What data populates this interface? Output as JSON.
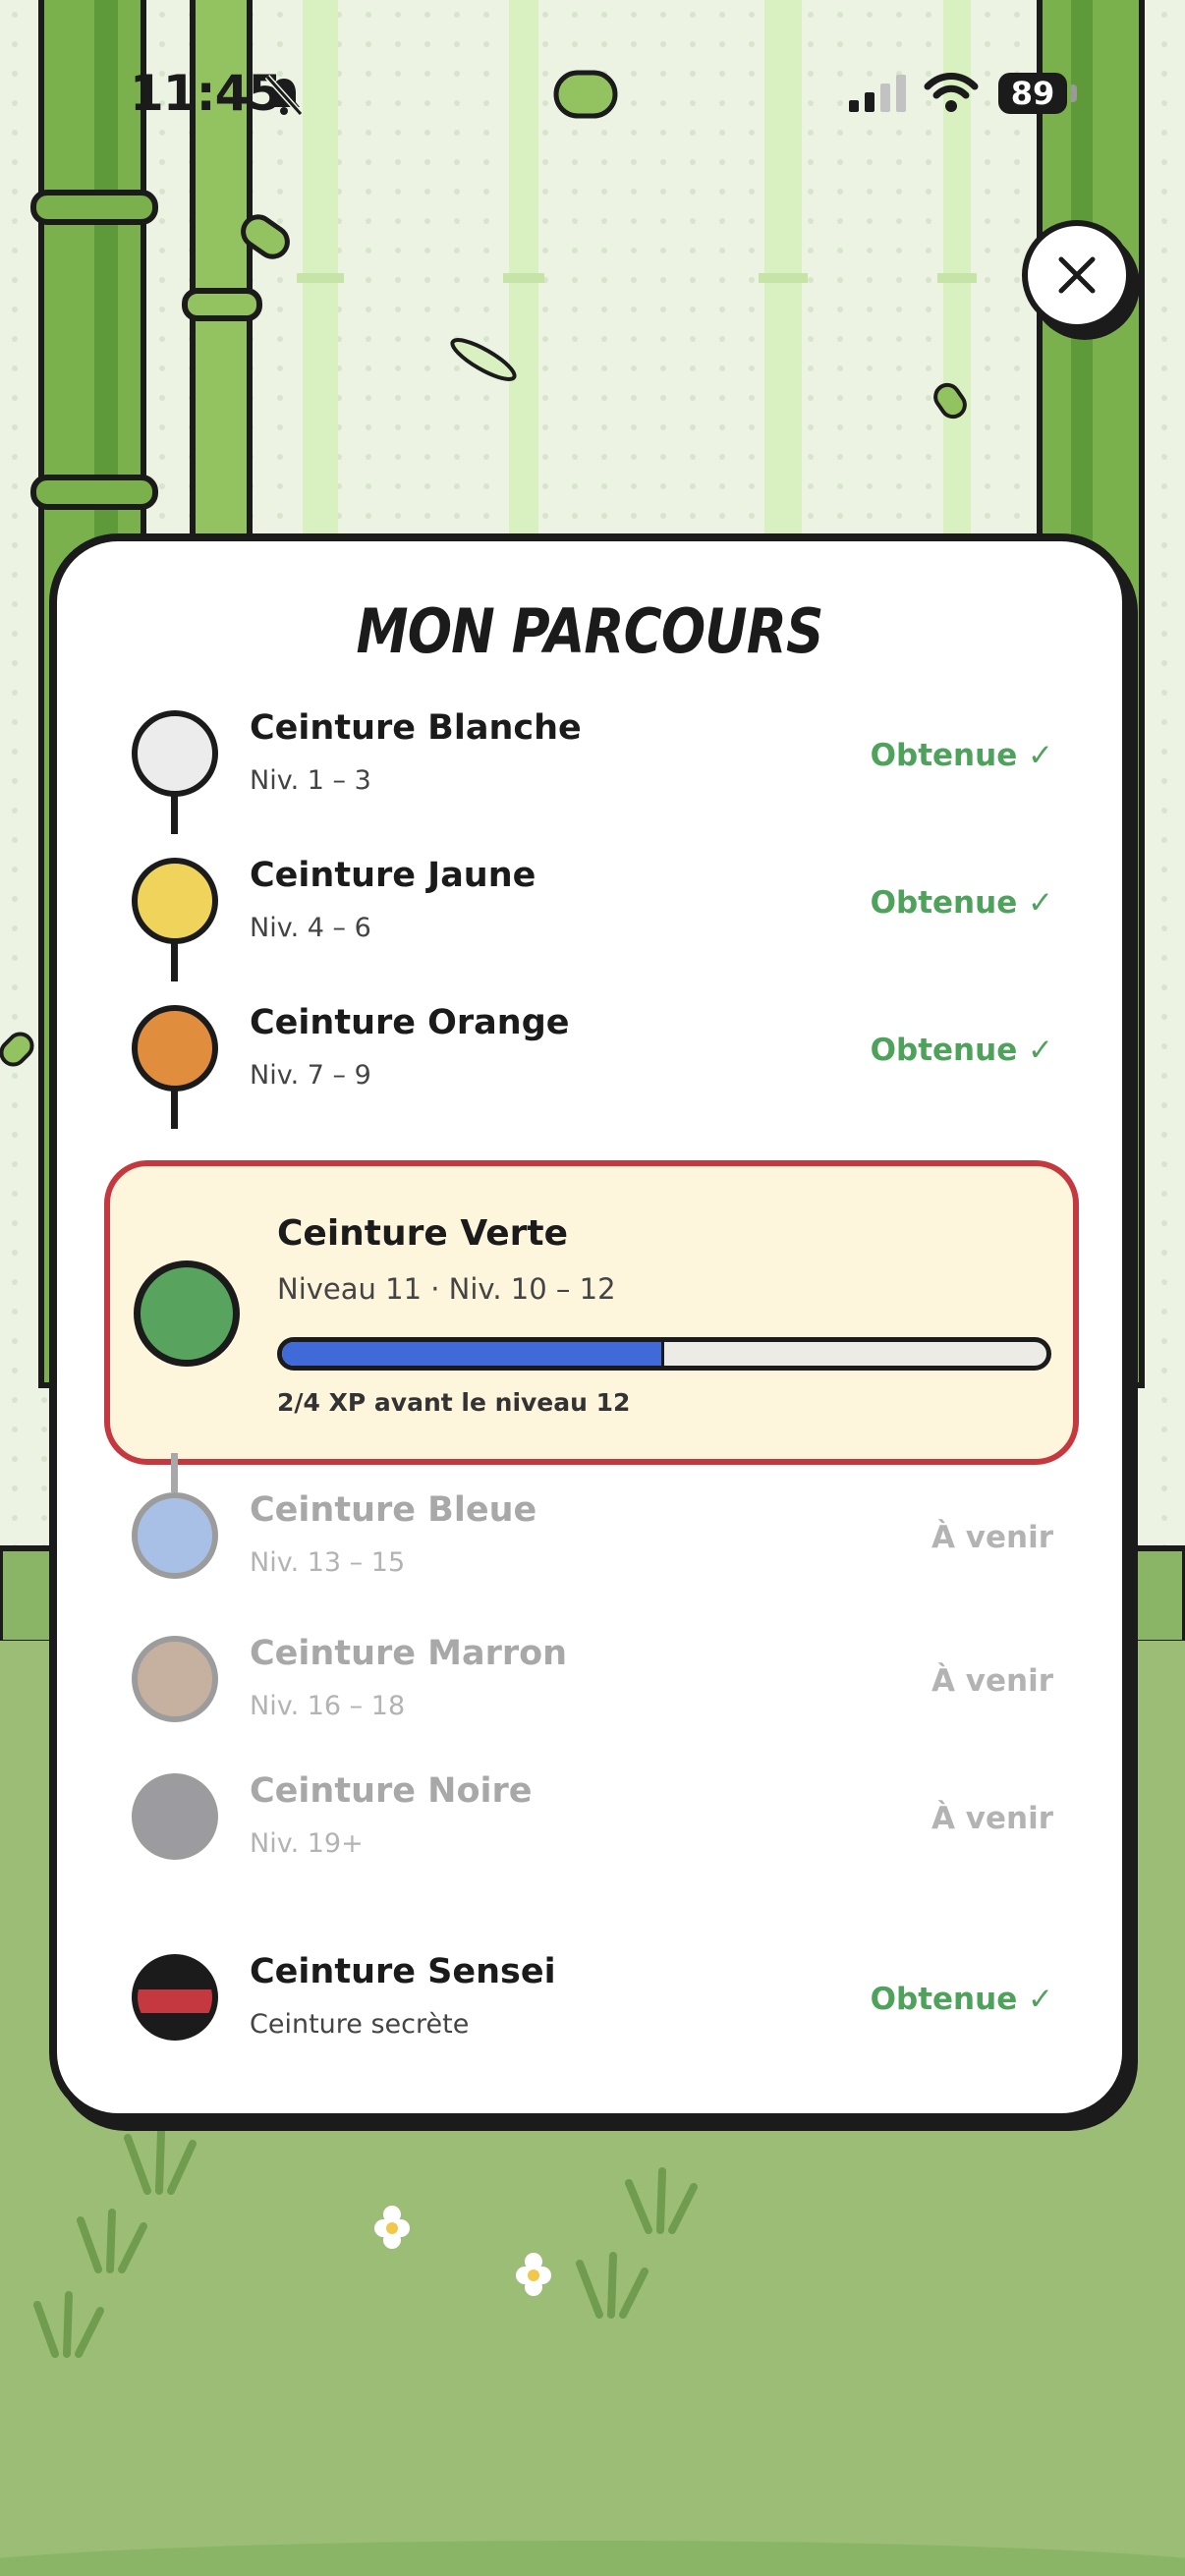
{
  "status_bar": {
    "time": "11:45",
    "battery": "89",
    "icons": [
      "bell-muted-icon",
      "cellular-signal-icon",
      "wifi-icon",
      "battery-icon"
    ]
  },
  "close_icon": "close-icon",
  "title": "MON PARCOURS",
  "belts_done": [
    {
      "name": "Ceinture Blanche",
      "range": "Niv. 1 – 3",
      "status": "Obtenue ✓",
      "color": "#ececec"
    },
    {
      "name": "Ceinture Jaune",
      "range": "Niv. 4 – 6",
      "status": "Obtenue ✓",
      "color": "#efd35a"
    },
    {
      "name": "Ceinture Orange",
      "range": "Niv. 7 – 9",
      "status": "Obtenue ✓",
      "color": "#e08d3e"
    }
  ],
  "current": {
    "name": "Ceinture Verte",
    "level": "Niveau 11 · Niv. 10 – 12",
    "progress_fraction": 0.5,
    "xp_text": "2/4 XP avant le niveau 12",
    "color": "#58a45e"
  },
  "belts_locked": [
    {
      "name": "Ceinture Bleue",
      "range": "Niv. 13 – 15",
      "status": "À venir",
      "color": "#a9c0e6"
    },
    {
      "name": "Ceinture Marron",
      "range": "Niv. 16 – 18",
      "status": "À venir",
      "color": "#c6b0a0"
    },
    {
      "name": "Ceinture Noire",
      "range": "Niv. 19+",
      "status": "À venir",
      "color": "#9c9ca0"
    }
  ],
  "sensei": {
    "name": "Ceinture Sensei",
    "subtitle": "Ceinture secrète",
    "status": "Obtenue ✓"
  },
  "colors": {
    "obtained": "#4ea25b",
    "locked": "#b3b3b3",
    "highlight_border": "#c5383f",
    "highlight_bg": "#fdf6dd",
    "progress": "#3f6ad8"
  }
}
